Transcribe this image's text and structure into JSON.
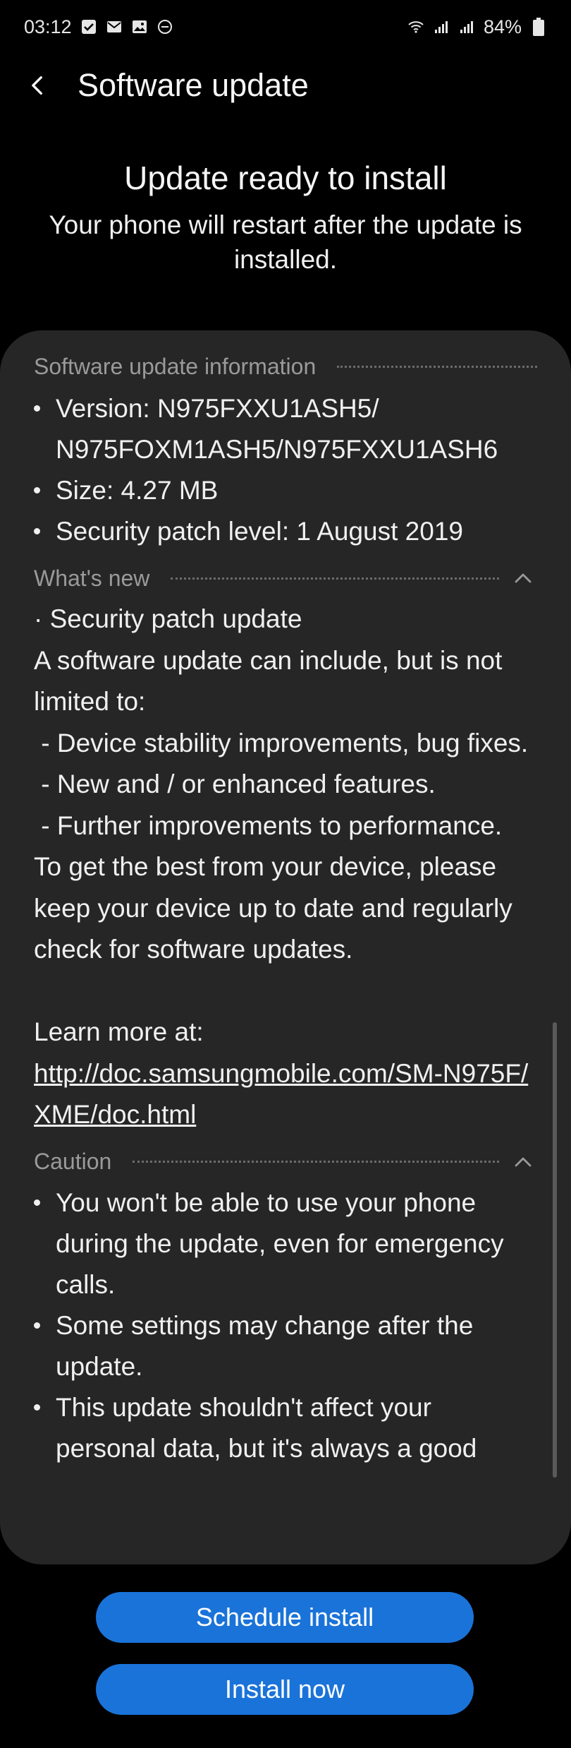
{
  "status_bar": {
    "time": "03:12",
    "battery": "84%",
    "left_icons": [
      "checkbox-icon",
      "mail-icon",
      "image-icon",
      "do-not-disturb-icon"
    ],
    "right_icons": [
      "wifi-icon",
      "signal-icon",
      "signal-roaming-icon",
      "battery-icon"
    ]
  },
  "app_bar": {
    "title": "Software update"
  },
  "header": {
    "title": "Update ready to install",
    "subtitle": "Your phone will restart after the update is installed."
  },
  "info_section": {
    "title": "Software update information",
    "items": [
      "Version: N975FXXU1ASH5/ N975FOXM1ASH5/N975FXXU1ASH6",
      "Size: 4.27 MB",
      "Security patch level: 1 August 2019"
    ]
  },
  "whats_new": {
    "title": "What's new",
    "body": "· Security patch update\nA software update can include, but is not limited to:\n - Device stability improvements, bug fixes.\n - New and / or enhanced features.\n - Further improvements to performance.\nTo get the best from your device, please keep your device up to date and regularly check for software updates.\n\nLearn more at:",
    "link": "http://doc.samsungmobile.com/SM-N975F/XME/doc.html"
  },
  "caution": {
    "title": "Caution",
    "items": [
      "You won't be able to use your phone during the update, even for emergency calls.",
      "Some settings may change after the update.",
      "This update shouldn't affect your personal data, but it's always a good"
    ]
  },
  "buttons": {
    "schedule": "Schedule install",
    "install": "Install now"
  },
  "colors": {
    "background": "#000000",
    "card": "#262626",
    "accent": "#1a73d9",
    "section_header": "#9a9a9a"
  }
}
